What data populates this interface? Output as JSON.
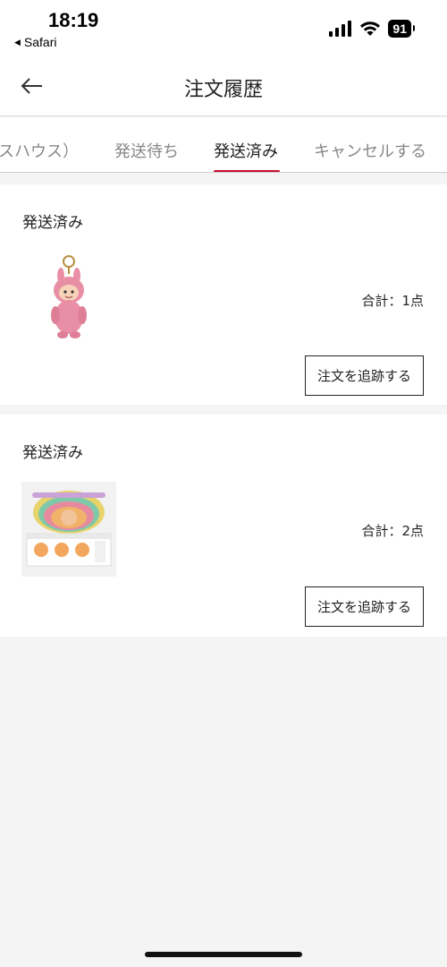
{
  "status_bar": {
    "time": "18:19",
    "back_app": "Safari",
    "battery": "91"
  },
  "header": {
    "title": "注文履歴"
  },
  "tabs": [
    {
      "label": "スハウス）"
    },
    {
      "label": "発送待ち"
    },
    {
      "label": "発送済み",
      "active": true
    },
    {
      "label": "キャンセルする"
    }
  ],
  "orders": [
    {
      "status": "発送済み",
      "total": "合計：1点",
      "track_label": "注文を追跡する",
      "thumb_icon": "pink-bunny-keychain-figure"
    },
    {
      "status": "発送済み",
      "total": "合計：2点",
      "track_label": "注文を追跡する",
      "thumb_icon": "blind-box-set-image"
    }
  ],
  "colors": {
    "accent": "#c8102e",
    "background": "#f4f4f4"
  }
}
